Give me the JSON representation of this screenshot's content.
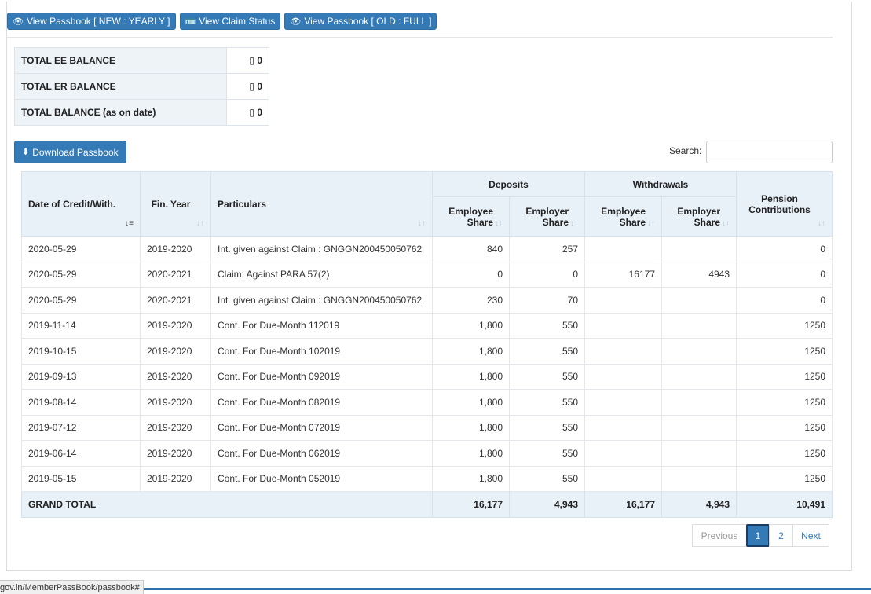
{
  "topbar": {
    "buttons": [
      {
        "icon": "eye-icon",
        "glyph": "👁",
        "label": "View Passbook [ NEW : YEARLY ]"
      },
      {
        "icon": "id-card-icon",
        "glyph": "🪪",
        "label": "View Claim Status"
      },
      {
        "icon": "eye-icon",
        "glyph": "👁",
        "label": "View Passbook [ OLD : FULL ]"
      }
    ]
  },
  "balances": [
    {
      "label": "TOTAL EE BALANCE",
      "value": "0"
    },
    {
      "label": "TOTAL ER BALANCE",
      "value": "0"
    },
    {
      "label": "TOTAL BALANCE (as on date)",
      "value": "0"
    }
  ],
  "download": {
    "icon": "download-icon",
    "label": "Download Passbook"
  },
  "search": {
    "label": "Search:",
    "value": ""
  },
  "table": {
    "headers": {
      "date": "Date of Credit/With.",
      "fin_year": "Fin. Year",
      "particulars": "Particulars",
      "deposits": "Deposits",
      "withdrawals": "Withdrawals",
      "pension": "Pension Contributions",
      "dep_employee": "Employee Share",
      "dep_employer": "Employer Share",
      "wd_employee": "Employee Share",
      "wd_employer": "Employer Share"
    },
    "rows": [
      [
        "2020-05-29",
        "2019-2020",
        "Int. given against Claim : GNGGN200450050762",
        "840",
        "257",
        "",
        "",
        "0"
      ],
      [
        "2020-05-29",
        "2020-2021",
        "Claim: Against PARA 57(2)",
        "0",
        "0",
        "16177",
        "4943",
        "0"
      ],
      [
        "2020-05-29",
        "2020-2021",
        "Int. given against Claim : GNGGN200450050762",
        "230",
        "70",
        "",
        "",
        "0"
      ],
      [
        "2019-11-14",
        "2019-2020",
        "Cont. For Due-Month 112019",
        "1,800",
        "550",
        "",
        "",
        "1250"
      ],
      [
        "2019-10-15",
        "2019-2020",
        "Cont. For Due-Month 102019",
        "1,800",
        "550",
        "",
        "",
        "1250"
      ],
      [
        "2019-09-13",
        "2019-2020",
        "Cont. For Due-Month 092019",
        "1,800",
        "550",
        "",
        "",
        "1250"
      ],
      [
        "2019-08-14",
        "2019-2020",
        "Cont. For Due-Month 082019",
        "1,800",
        "550",
        "",
        "",
        "1250"
      ],
      [
        "2019-07-12",
        "2019-2020",
        "Cont. For Due-Month 072019",
        "1,800",
        "550",
        "",
        "",
        "1250"
      ],
      [
        "2019-06-14",
        "2019-2020",
        "Cont. For Due-Month 062019",
        "1,800",
        "550",
        "",
        "",
        "1250"
      ],
      [
        "2019-05-15",
        "2019-2020",
        "Cont. For Due-Month 052019",
        "1,800",
        "550",
        "",
        "",
        "1250"
      ]
    ],
    "total": {
      "label": "GRAND TOTAL",
      "dep_employee": "16,177",
      "dep_employer": "4,943",
      "wd_employee": "16,177",
      "wd_employer": "4,943",
      "pension": "10,491"
    }
  },
  "pagination": {
    "previous": "Previous",
    "pages": [
      "1",
      "2"
    ],
    "current": "1",
    "next": "Next"
  },
  "statusbar": {
    "url": "gov.in/MemberPassBook/passbook#"
  },
  "colors": {
    "primary": "#337ab7",
    "header_bg": "#e8f0f8"
  }
}
